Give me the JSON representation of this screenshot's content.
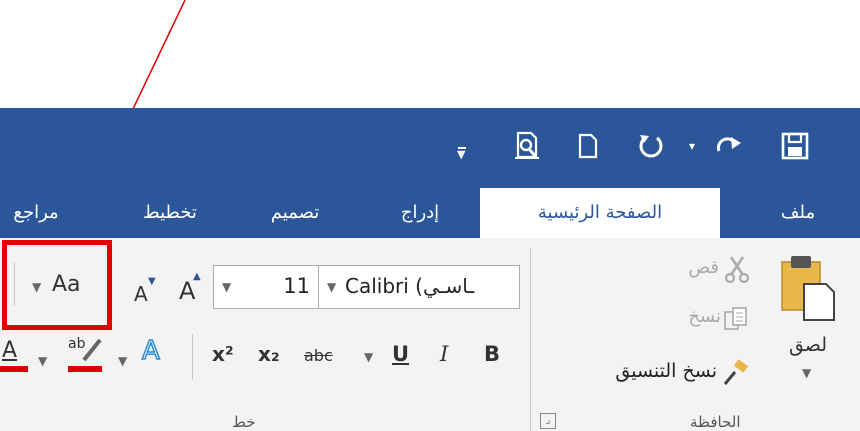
{
  "qat": {
    "save_icon": "save-icon",
    "redo_icon": "redo-icon",
    "undo_icon": "undo-icon",
    "new_icon": "new-document-icon",
    "preview_icon": "print-preview-icon",
    "customize_icon": "customize-qat-icon"
  },
  "tabs": {
    "file": "ملف",
    "home": "الصفحة الرئيسية",
    "insert": "إدراج",
    "design": "تصميم",
    "layout": "تخطيط",
    "references": "مراجع"
  },
  "clipboard": {
    "paste": "لصق",
    "cut": "قص",
    "copy": "نسخ",
    "format_painter": "نسخ التنسيق",
    "group_label": "الحافظة"
  },
  "font": {
    "font_name": "Calibri (نص أساسي)",
    "font_name_visible": "Calibri (ـاسـي",
    "font_size": "11",
    "change_case": "Aa",
    "bold": "B",
    "italic": "I",
    "underline": "U",
    "strikethrough": "abc",
    "subscript": "x₂",
    "superscript": "x²",
    "text_effects": "A",
    "highlight": "ab",
    "font_color": "A",
    "group_label": "خط",
    "grow_font": "A",
    "shrink_font": "A"
  },
  "annotation": {
    "highlight_color": "#e00000",
    "arrow_color": "#e00000"
  },
  "colors": {
    "ribbon_blue": "#2b579a",
    "highlight_red": "#e00000"
  }
}
